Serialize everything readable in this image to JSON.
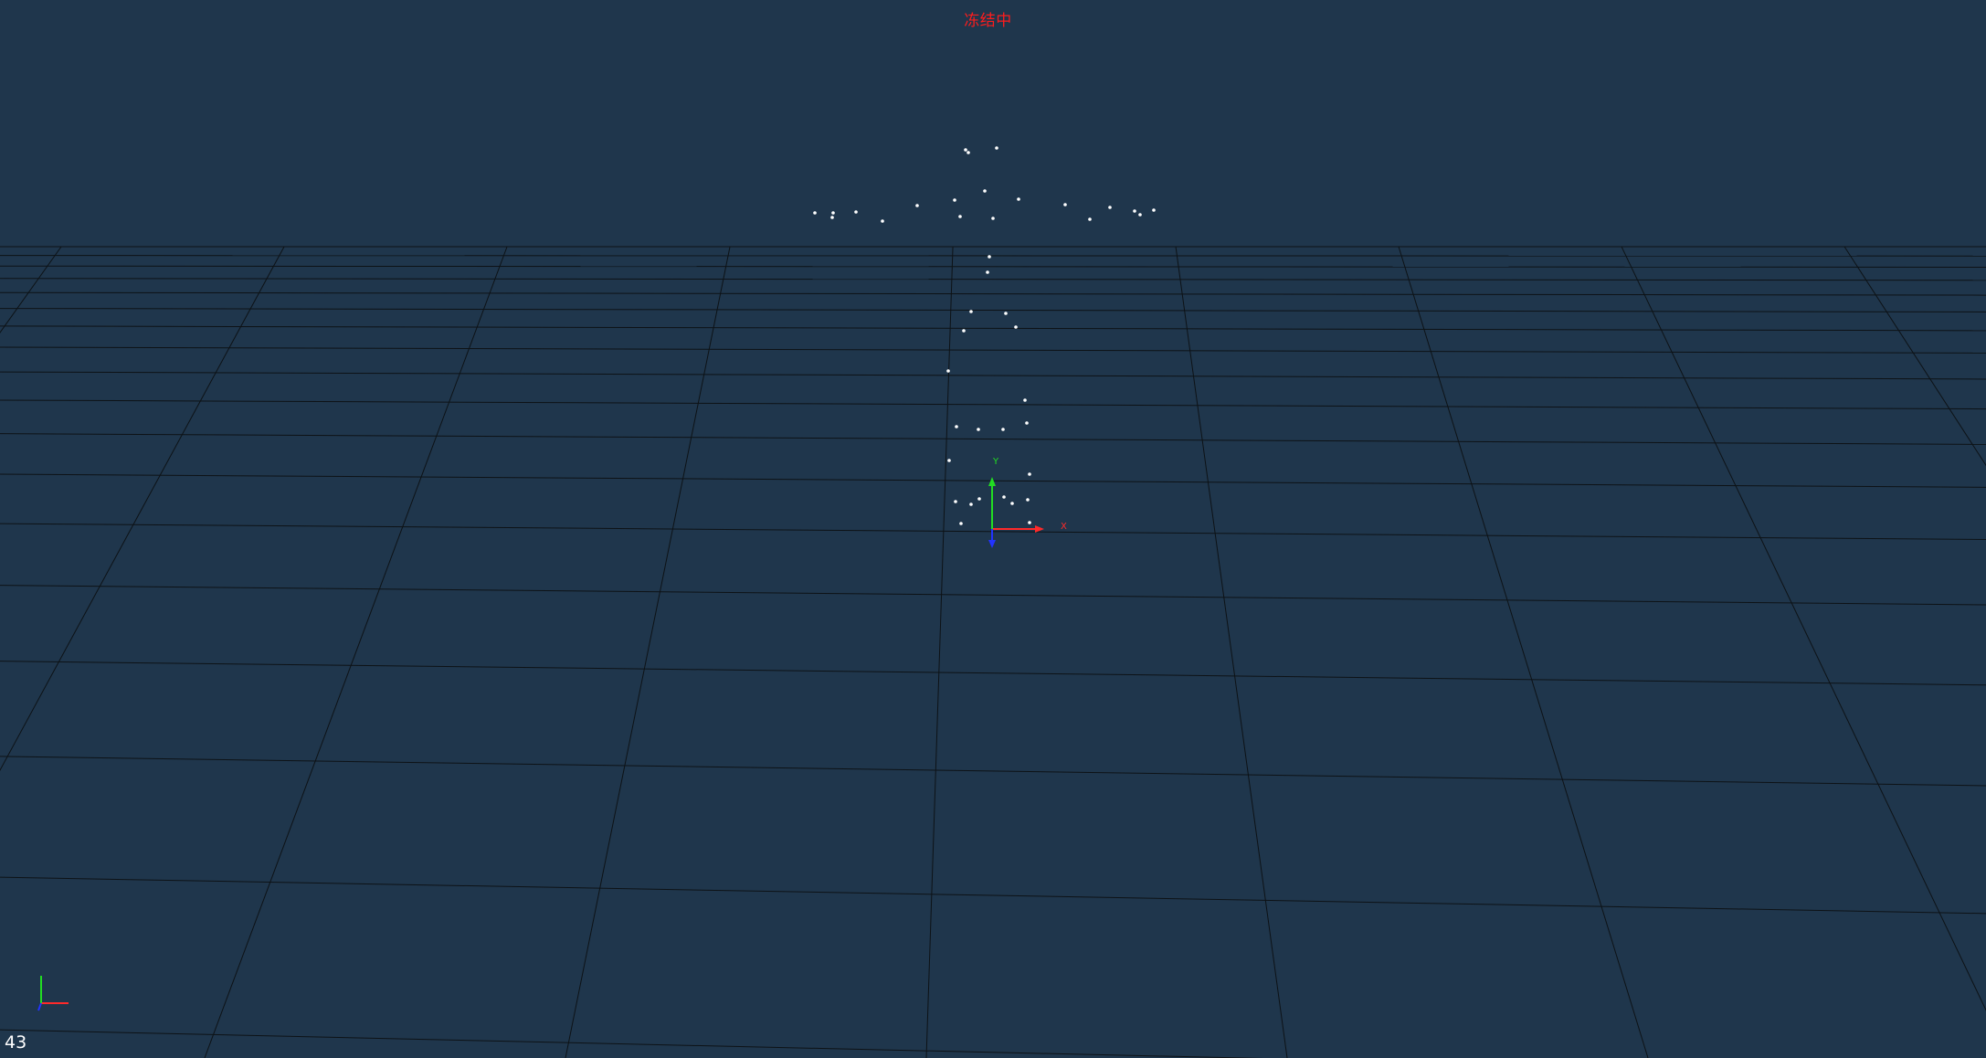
{
  "viewer": {
    "status_text": "冻结中",
    "fps": "43",
    "background_color": "#1f364c",
    "grid_line_color": "#0d1216",
    "point_color": "#ffffff",
    "axis_colors": {
      "x": "#ff2a2a",
      "y": "#22dd22",
      "z": "#2233ff"
    },
    "axis_labels": {
      "x": "X",
      "y": "Y"
    }
  }
}
